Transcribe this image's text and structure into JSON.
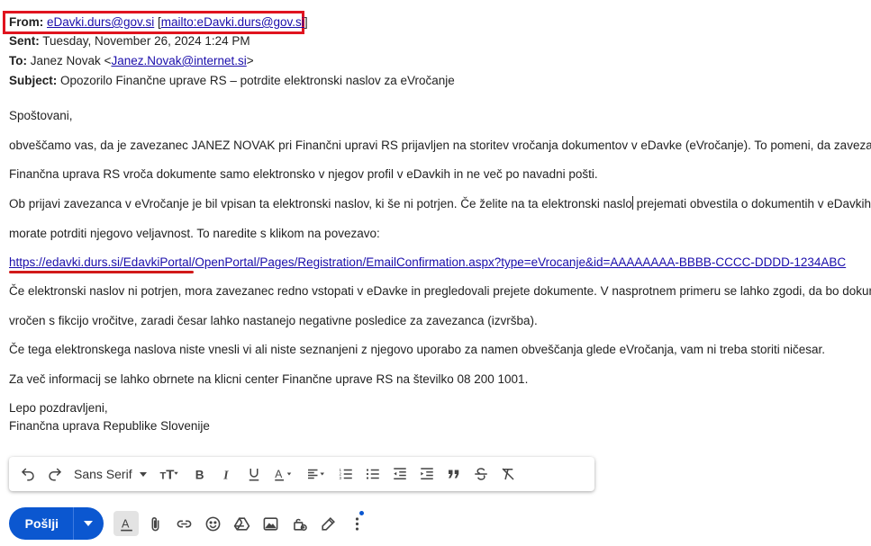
{
  "header": {
    "from_label": "From:",
    "from_email": "eDavki.durs@gov.si",
    "from_mailto_open": "[",
    "from_mailto": "mailto:eDavki.durs@gov.si",
    "from_mailto_close": "]",
    "sent_label": "Sent:",
    "sent_value": "Tuesday, November 26, 2024 1:24 PM",
    "to_label": "To:",
    "to_name": "Janez Novak <",
    "to_email": "Janez.Novak@internet.si",
    "to_close": ">",
    "subject_label": "Subject:",
    "subject_value": "Opozorilo Finančne uprave RS – potrdite elektronski naslov za eVročanje"
  },
  "body": {
    "greeting": "Spoštovani,",
    "p1_line1": "obveščamo vas, da je zavezanec JANEZ NOVAK pri Finančni upravi RS prijavljen na storitev vročanja dokumentov v eDavke (eVročanje). To pomeni, da zavezancu",
    "p1_line2": "Finančna uprava RS vroča dokumente samo elektronsko v njegov profil v eDavkih in ne več po navadni pošti.",
    "p2_line1a": "Ob prijavi zavezanca v eVročanje je bil vpisan ta elektronski naslov, ki še ni potrjen. Če želite na ta elektronski naslo",
    "p2_line1b": " prejemati obvestila o dokumentih v eDavkih,",
    "p2_line2": "morate potrditi njegovo veljavnost. To naredite s klikom na povezavo:",
    "link": "https://edavki.durs.si/EdavkiPortal/OpenPortal/Pages/Registration/EmailConfirmation.aspx?type=eVrocanje&id=AAAAAAAA-BBBB-CCCC-DDDD-1234ABC",
    "p3_line1": "Če elektronski naslov ni potrjen, mora zavezanec redno vstopati v eDavke in pregledovali prejete dokumente. V nasprotnem primeru se lahko zgodi, da bo dokument",
    "p3_line2": "vročen s fikcijo vročitve, zaradi česar lahko nastanejo negativne posledice za zavezanca (izvršba).",
    "p4": "Če tega elektronskega naslova niste vnesli vi ali niste seznanjeni z njegovo uporabo za namen obveščanja glede eVročanja, vam ni treba storiti ničesar.",
    "p5": "Za več informacij se lahko obrnete na klicni center Finančne uprave RS na številko 08 200 1001.",
    "closing": "Lepo pozdravljeni,",
    "signature": "Finančna uprava Republike Slovenije"
  },
  "toolbar": {
    "font": "Sans Serif",
    "icons": [
      "undo-icon",
      "redo-icon",
      "text-size-icon",
      "bold-icon",
      "italic-icon",
      "underline-icon",
      "text-color-icon",
      "align-icon",
      "numbered-list-icon",
      "bulleted-list-icon",
      "indent-less-icon",
      "indent-more-icon",
      "quote-icon",
      "strikethrough-icon",
      "remove-formatting-icon"
    ]
  },
  "compose": {
    "send_label": "Pošlji",
    "icons": [
      "formatting-options-icon",
      "attach-icon",
      "link-icon",
      "emoji-icon",
      "drive-icon",
      "photo-icon",
      "confidential-icon",
      "signature-icon",
      "more-options-icon"
    ]
  },
  "colors": {
    "highlight": "#e0141f",
    "link": "#1a0dab",
    "send": "#0b57d0"
  }
}
